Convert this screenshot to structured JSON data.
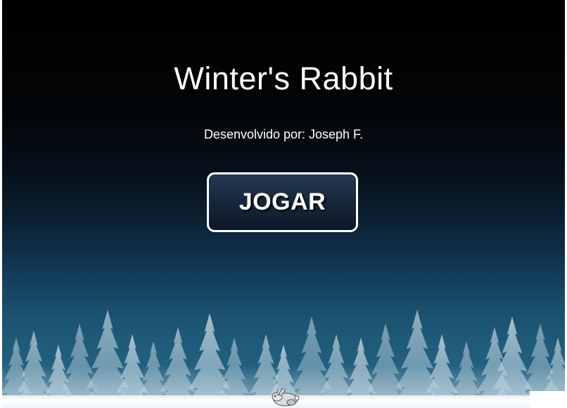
{
  "game": {
    "title": "Winter's Rabbit",
    "credit": "Desenvolvido por: Joseph F.",
    "play_label": "JOGAR"
  },
  "scene": {
    "sky_top_color": "#000000",
    "sky_bottom_color": "#2a6a88",
    "button_color": "#17283d",
    "snow_color": "#ffffff",
    "sprite": "rabbit-icon"
  }
}
